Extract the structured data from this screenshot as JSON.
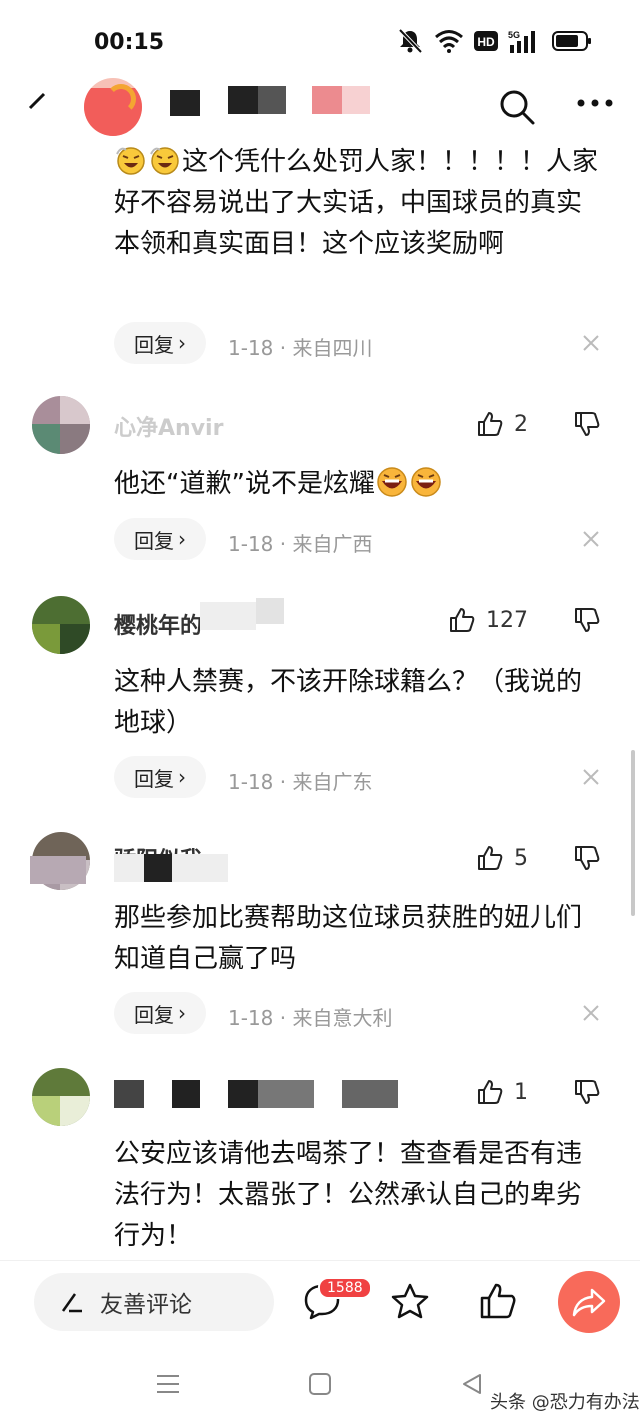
{
  "status_bar": {
    "time": "00:15",
    "icons": [
      "mute-bell-icon",
      "wifi-icon",
      "hd-icon",
      "5g-signal-icon",
      "battery-icon"
    ],
    "network": "5G",
    "hd": "HD"
  },
  "top_bar": {
    "icons": [
      "edit-icon",
      "search-icon",
      "more-icon"
    ]
  },
  "comments": [
    {
      "text_after_emoji": "这个凭什么处罚人家！！！！！人家好不容易说出了大实话，中国球员的真实本领和真实面目！这个应该奖励啊",
      "reply_label": "回复",
      "meta": "1-18 · 来自四川"
    },
    {
      "name": "心净Anvir",
      "likes": "2",
      "text": "他还“道歉”说不是炫耀",
      "reply_label": "回复",
      "meta": "1-18 · 来自广西"
    },
    {
      "name": "樱桃年的",
      "likes": "127",
      "text": "这种人禁赛，不该开除球籍么？（我说的地球）",
      "reply_label": "回复",
      "meta": "1-18 · 来自广东"
    },
    {
      "name": "骄阳似我",
      "likes": "5",
      "text": "那些参加比赛帮助这位球员获胜的妞儿们知道自己赢了吗",
      "reply_label": "回复",
      "meta": "1-18 · 来自意大利"
    },
    {
      "name": "",
      "likes": "1",
      "text": "公安应该请他去喝茶了！查查看是否有违法行为！太嚣张了！公然承认自己的卑劣行为！"
    }
  ],
  "bottom_bar": {
    "input_placeholder": "友善评论",
    "comment_count": "1588"
  },
  "nav_bar": {
    "watermark": "头条 @恐力有办法"
  },
  "colors": {
    "accent_red": "#f04142",
    "share_orange": "#f86a5a",
    "meta_gray": "#999999"
  }
}
